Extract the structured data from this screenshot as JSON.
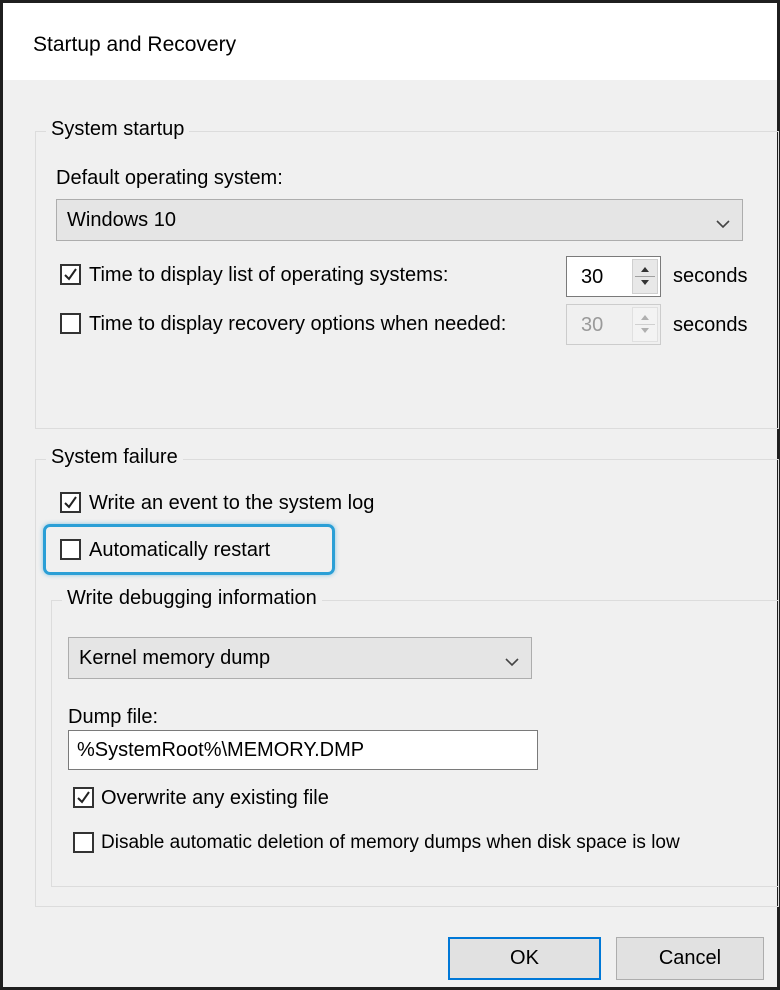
{
  "window": {
    "title": "Startup and Recovery"
  },
  "system_startup": {
    "group_label": "System startup",
    "default_os_label": "Default operating system:",
    "default_os_value": "Windows 10",
    "display_list": {
      "label": "Time to display list of operating systems:",
      "checked": true,
      "value": "30",
      "unit": "seconds"
    },
    "display_recovery": {
      "label": "Time to display recovery options when needed:",
      "checked": false,
      "value": "30",
      "unit": "seconds",
      "disabled": true
    }
  },
  "system_failure": {
    "group_label": "System failure",
    "write_event": {
      "label": "Write an event to the system log",
      "checked": true
    },
    "auto_restart": {
      "label": "Automatically restart",
      "checked": false,
      "highlighted": true
    },
    "debug_group_label": "Write debugging information",
    "debug_type_value": "Kernel memory dump",
    "dump_file_label": "Dump file:",
    "dump_file_value": "%SystemRoot%\\MEMORY.DMP",
    "overwrite": {
      "label": "Overwrite any existing file",
      "checked": true
    },
    "disable_auto_delete": {
      "label": "Disable automatic deletion of memory dumps when disk space is low",
      "checked": false
    }
  },
  "buttons": {
    "ok": "OK",
    "cancel": "Cancel"
  },
  "colors": {
    "highlight": "#2a9fd6",
    "default_button_border": "#0078d7",
    "dialog_bg": "#f0f0f0"
  },
  "icons": {
    "checkmark": "check-icon",
    "dropdown": "chevron-down-icon",
    "spinner": "spin-arrows-icon"
  }
}
